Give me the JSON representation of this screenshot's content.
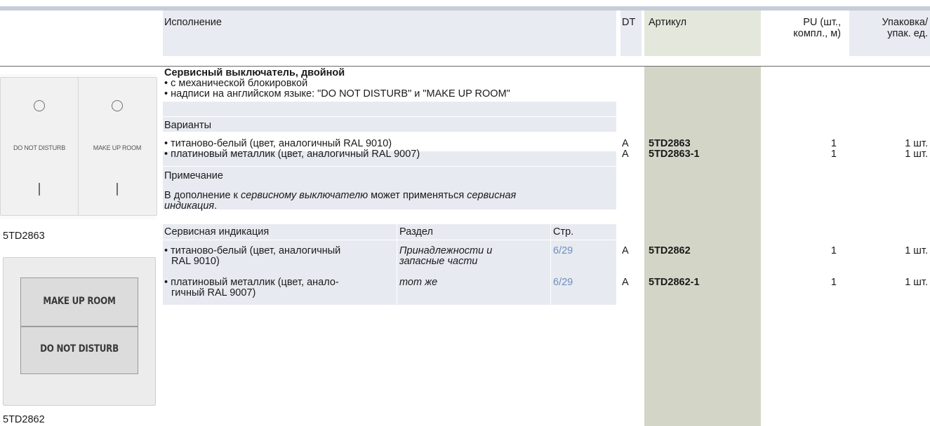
{
  "header": {
    "execution": "Исполнение",
    "dt": "DT",
    "article": "Артикул",
    "pu_l1": "PU (шт.,",
    "pu_l2": "компл., м)",
    "pack_l1": "Упаковка/",
    "pack_l2": "упак. ед."
  },
  "product1": {
    "title": "Сервисный выключатель, двойной",
    "bullet1": "• с механической блокировкой",
    "bullet2": "• надписи на английском языке: \"DO NOT DISTURB\" и \"MAKE UP ROOM\"",
    "variants_label": "Варианты",
    "variants": [
      {
        "text": "• титаново-белый (цвет, аналогичный RAL 9010)",
        "dt": "A",
        "article": "5TD2863",
        "pu": "1",
        "pack": "1 шт."
      },
      {
        "text": "• платиновый металлик (цвет, аналогичный RAL 9007)",
        "dt": "A",
        "article": "5TD2863-1",
        "pu": "1",
        "pack": "1 шт."
      }
    ],
    "note_label": "Примечание",
    "note_part1": "В дополнение к ",
    "note_italic1": "сервисному выключателю",
    "note_part2": " может применяться ",
    "note_italic2": "сервисная",
    "note_line2_italic": "индикация",
    "note_line2_end": "."
  },
  "indication": {
    "col1": "Сервисная индикация",
    "col2": "Раздел",
    "col3": "Стр.",
    "rows": [
      {
        "l1": "• титаново-белый (цвет, аналогичный",
        "l2": "RAL 9010)",
        "sec1": "Принадлежности и",
        "sec2": "запасные части",
        "page": "6/29",
        "dt": "A",
        "article": "5TD2862",
        "pu": "1",
        "pack": "1 шт."
      },
      {
        "l1": "• платиновый металлик (цвет, анало-",
        "l2": "гичный RAL 9007)",
        "sec1": "тот же",
        "sec2": "",
        "page": "6/29",
        "dt": "A",
        "article": "5TD2862-1",
        "pu": "1",
        "pack": "1 шт."
      }
    ]
  },
  "images": {
    "img1_caption": "5TD2863",
    "img1_left_label": "DO NOT DISTURB",
    "img1_right_label": "MAKE UP ROOM",
    "img2_caption": "5TD2862",
    "img2_top": "MAKE UP ROOM",
    "img2_bottom": "DO NOT DISTURB"
  },
  "colors": {
    "header_bg": "#e8ebf1",
    "article_column": "#d3d6c7",
    "link": "#6d8fbf"
  }
}
